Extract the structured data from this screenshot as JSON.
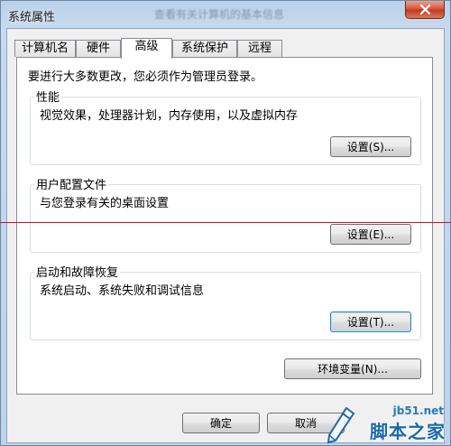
{
  "window": {
    "title": "系统属性",
    "background_title": "查看有关计算机的基本信息"
  },
  "tabs": [
    {
      "label": "计算机名",
      "active": false
    },
    {
      "label": "硬件",
      "active": false
    },
    {
      "label": "高级",
      "active": true
    },
    {
      "label": "系统保护",
      "active": false
    },
    {
      "label": "远程",
      "active": false
    }
  ],
  "panel": {
    "admin_note": "要进行大多数更改，您必须作为管理员登录。",
    "performance": {
      "title": "性能",
      "description": "视觉效果，处理器计划，内存使用，以及虚拟内存",
      "button": "设置(S)..."
    },
    "user_profiles": {
      "title": "用户配置文件",
      "description": "与您登录有关的桌面设置",
      "button": "设置(E)..."
    },
    "startup_recovery": {
      "title": "启动和故障恢复",
      "description": "系统启动、系统失败和调试信息",
      "button": "设置(T)..."
    },
    "env_vars_button": "环境变量(N)..."
  },
  "footer": {
    "ok": "确定",
    "cancel": "取消"
  },
  "watermark": {
    "site": "jb51.net",
    "brand": "脚本之家"
  },
  "colors": {
    "accent_line": "#c8102e",
    "close_button": "#c94a30",
    "watermark": "#1a6aa8"
  }
}
